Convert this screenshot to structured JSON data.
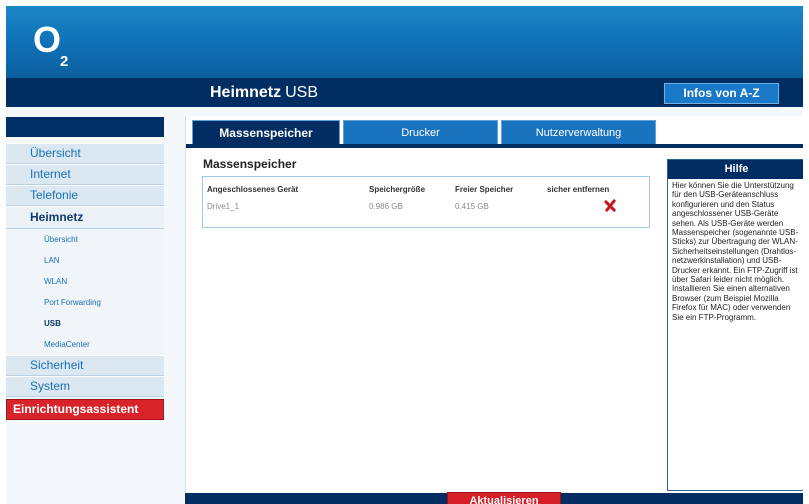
{
  "brand": {
    "logo_main": "O",
    "logo_sub": "2"
  },
  "header": {
    "title": "Heimnetz",
    "subtitle": "USB",
    "info_button": "Infos von A-Z"
  },
  "sidebar": {
    "items": [
      {
        "label": "Übersicht"
      },
      {
        "label": "Internet"
      },
      {
        "label": "Telefonie"
      },
      {
        "label": "Heimnetz"
      },
      {
        "label": "Sicherheit"
      },
      {
        "label": "System"
      }
    ],
    "subitems": [
      {
        "label": "Übersicht"
      },
      {
        "label": "LAN"
      },
      {
        "label": "WLAN"
      },
      {
        "label": "Port Forwarding"
      },
      {
        "label": "USB"
      },
      {
        "label": "MediaCenter"
      }
    ],
    "wizard": "Einrichtungsassistent"
  },
  "tabs": [
    {
      "label": "Massenspeicher"
    },
    {
      "label": "Drucker"
    },
    {
      "label": "Nutzerverwaltung"
    }
  ],
  "main": {
    "section_title": "Massenspeicher",
    "columns": [
      "Angeschlossenes Gerät",
      "Speichergröße",
      "Freier Speicher",
      "sicher entfernen"
    ],
    "rows": [
      {
        "device": "Drive1_1",
        "size": "0.986 GB",
        "free": "0.415 GB"
      }
    ]
  },
  "help": {
    "title": "Hilfe",
    "text": "Hier können Sie die Unterstützung für den USB-Geräteanschluss konfigurieren und den Status angeschlossener USB-Geräte sehen. Als USB-Geräte werden Massenspeicher (sogenannte USB-Sticks) zur Übertragung der WLAN-Sicherheitseinstellungen (Drahtlos-netzwerkinstallation) und USB-Drucker erkannt. Ein FTP-Zugriff ist über Safari leider nicht möglich. Installieren Sie einen alternativen Browser (zum Beispiel Mozilla Firefox für MAC) oder verwenden Sie ein FTP-Programm."
  },
  "footer": {
    "refresh_button": "Aktualisieren"
  },
  "colors": {
    "brand_blue": "#0f6fb5",
    "navy": "#012d63",
    "accent_red": "#d61f26"
  },
  "icons": {
    "remove": "red-x-icon"
  }
}
